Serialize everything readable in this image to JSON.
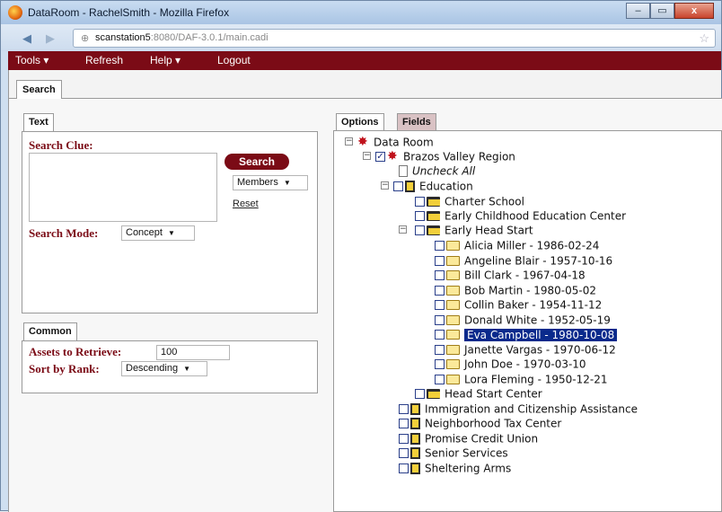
{
  "browser": {
    "title": "DataRoom - RachelSmith - Mozilla Firefox",
    "url_host": "scanstation5",
    "url_rest": ":8080/DAF-3.0.1/main.cadi",
    "minimize_glyph": "–",
    "maximize_glyph": "▭",
    "close_glyph": "x"
  },
  "menu": {
    "tools": "Tools ▾",
    "refresh": "Refresh",
    "help": "Help ▾",
    "logout": "Logout"
  },
  "main_tab": "Search",
  "text_panel": {
    "tab": "Text",
    "search_clue_label": "Search Clue:",
    "search_clue_value": "",
    "search_button": "Search",
    "members_select": "Members",
    "reset_link": "Reset",
    "search_mode_label": "Search Mode:",
    "search_mode_value": "Concept"
  },
  "common_panel": {
    "tab": "Common",
    "assets_label": "Assets to Retrieve:",
    "assets_value": "100",
    "sort_label": "Sort by Rank:",
    "sort_value": "Descending"
  },
  "right_tabs": {
    "options": "Options",
    "fields": "Fields"
  },
  "tree": {
    "root": "Data Room",
    "region": "Brazos Valley Region",
    "uncheck_all": "Uncheck All",
    "education": "Education",
    "charter_school": "Charter School",
    "early_childhood": "Early Childhood Education Center",
    "early_head_start": "Early Head Start",
    "children": [
      "Alicia Miller - 1986-02-24",
      "Angeline Blair - 1957-10-16",
      "Bill Clark - 1967-04-18",
      "Bob Martin - 1980-05-02",
      "Collin Baker - 1954-11-12",
      "Donald White - 1952-05-19",
      "Eva Campbell - 1980-10-08",
      "Janette Vargas - 1970-06-12",
      "John Doe - 1970-03-10",
      "Lora Fleming - 1950-12-21"
    ],
    "selected_child": "Eva Campbell - 1980-10-08",
    "head_start_center": "Head Start Center",
    "orgs": [
      "Immigration and Citizenship Assistance",
      "Neighborhood Tax Center",
      "Promise Credit Union",
      "Senior Services",
      "Sheltering Arms"
    ]
  }
}
